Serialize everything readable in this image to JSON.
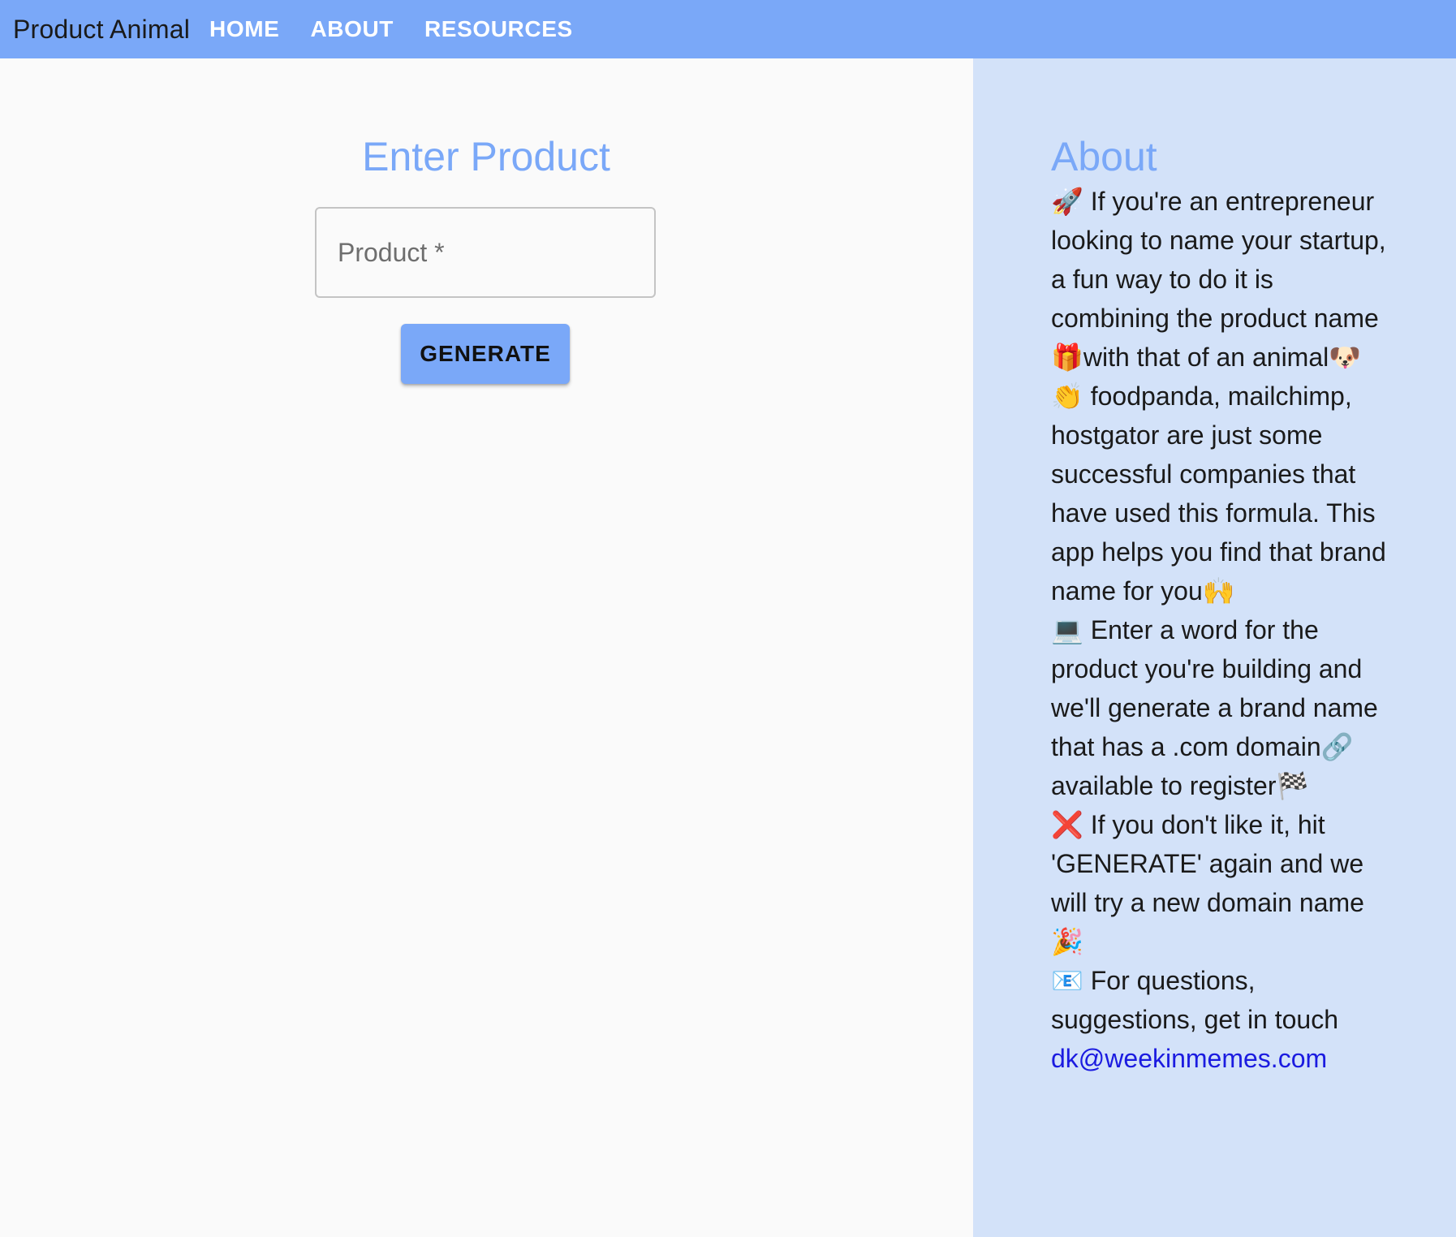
{
  "navbar": {
    "brand": "Product Animal",
    "links": [
      "HOME",
      "ABOUT",
      "RESOURCES"
    ]
  },
  "form": {
    "title": "Enter Product",
    "input_placeholder": "Product *",
    "input_value": "",
    "generate_label": "GENERATE"
  },
  "about": {
    "title": "About",
    "paragraphs": [
      {
        "icon": "rocket-icon",
        "glyph": "🚀",
        "text": "If you're an entrepreneur looking to name your startup, a fun way to do it is combining the product name 🎁with that of an animal🐶"
      },
      {
        "icon": "clapping-hands-icon",
        "glyph": "👏",
        "text": "foodpanda, mailchimp, hostgator are just some successful companies that have used this formula. This app helps you find that brand name for you🙌"
      },
      {
        "icon": "laptop-icon",
        "glyph": "💻",
        "text": "Enter a word for the product you're building and we'll generate a brand name that has a .com domain🔗 available to register🏁"
      },
      {
        "icon": "cross-mark-icon",
        "glyph": "❌",
        "text": "If you don't like it, hit 'GENERATE' again and we will try a new domain name 🎉"
      },
      {
        "icon": "envelope-icon",
        "glyph": "📧",
        "text": "For questions, suggestions, get in touch"
      }
    ],
    "contact_email": "dk@weekinmemes.com"
  },
  "colors": {
    "navbar_bg": "#7aa8f8",
    "accent": "#7aa8f8",
    "sidebar_bg": "#d3e2f9",
    "link": "#1b1be0"
  }
}
